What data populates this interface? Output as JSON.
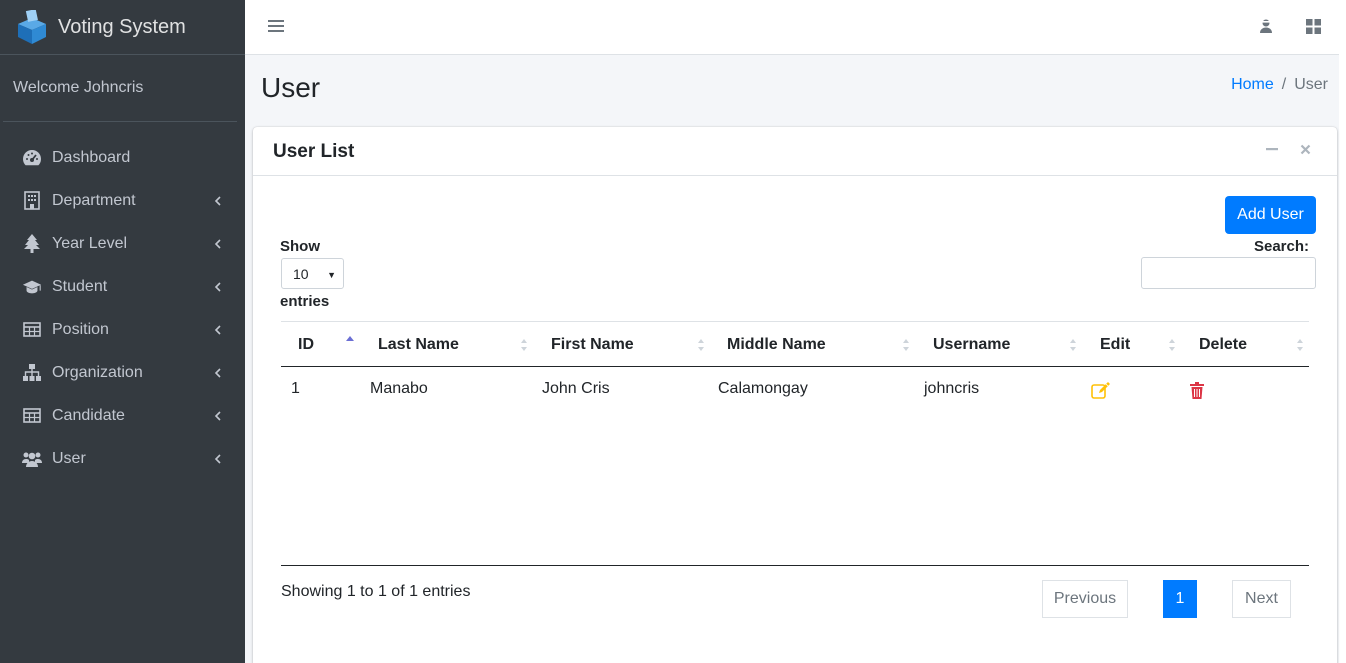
{
  "app": {
    "brand": "Voting System",
    "welcome": "Welcome Johncris"
  },
  "sidebar": {
    "items": [
      {
        "label": "Dashboard",
        "icon": "dashboard-icon",
        "has_children": false
      },
      {
        "label": "Department",
        "icon": "building-icon",
        "has_children": true
      },
      {
        "label": "Year Level",
        "icon": "tree-icon",
        "has_children": true
      },
      {
        "label": "Student",
        "icon": "graduation-cap-icon",
        "has_children": true
      },
      {
        "label": "Position",
        "icon": "table-icon",
        "has_children": true
      },
      {
        "label": "Organization",
        "icon": "sitemap-icon",
        "has_children": true
      },
      {
        "label": "Candidate",
        "icon": "table-icon",
        "has_children": true
      },
      {
        "label": "User",
        "icon": "users-icon",
        "has_children": true
      }
    ]
  },
  "header": {
    "title": "User",
    "breadcrumb_home": "Home",
    "breadcrumb_sep": "/",
    "breadcrumb_current": "User"
  },
  "card": {
    "title": "User List",
    "add_button": "Add User",
    "show_label": "Show",
    "page_size": "10",
    "entries_label": "entries",
    "search_label": "Search:",
    "search_value": ""
  },
  "table": {
    "columns": [
      "ID",
      "Last Name",
      "First Name",
      "Middle Name",
      "Username",
      "Edit",
      "Delete"
    ],
    "sorted_column": "ID",
    "sort_direction": "ascending",
    "rows": [
      {
        "id": "1",
        "last_name": "Manabo",
        "first_name": "John Cris",
        "middle_name": "Calamongay",
        "username": "johncris"
      }
    ]
  },
  "footer": {
    "info": "Showing 1 to 1 of 1 entries",
    "prev": "Previous",
    "current_page": "1",
    "next": "Next"
  },
  "colors": {
    "sidebar_bg": "#343a40",
    "accent": "#007bff",
    "edit": "#ffc107",
    "delete": "#dc3545"
  }
}
